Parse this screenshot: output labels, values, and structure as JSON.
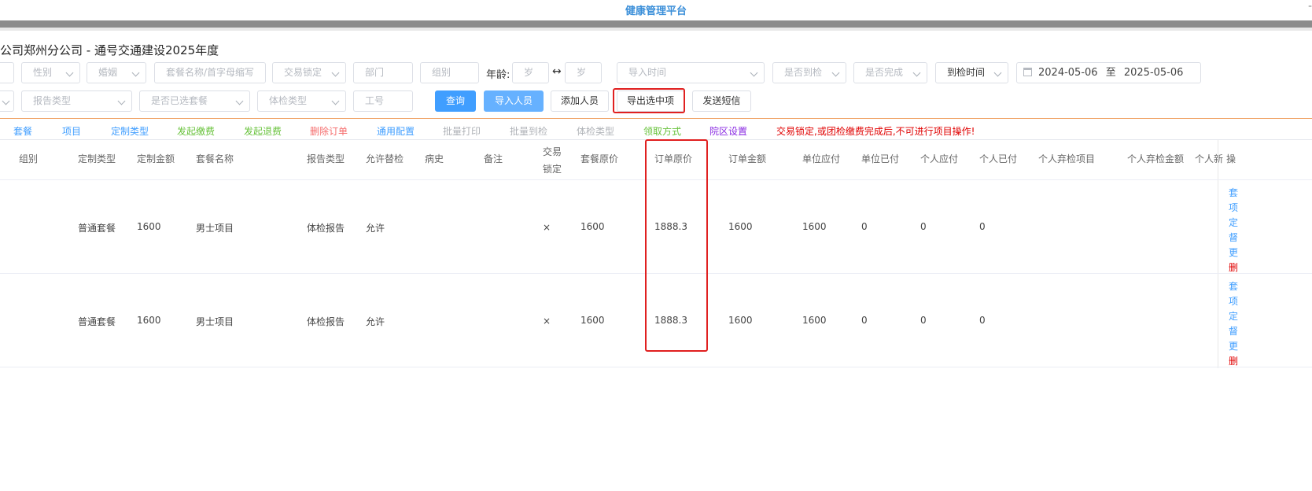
{
  "app": {
    "title": "健康管理平台",
    "minimize": "-"
  },
  "page": {
    "title": "公司郑州分公司 - 通号交通建设2025年度"
  },
  "filters": {
    "row1": {
      "gender": "性别",
      "marital": "婚姻",
      "package_search": "套餐名称/首字母缩写",
      "trade_lock": "交易锁定",
      "department": "部门",
      "group": "组别",
      "age_label": "年龄:",
      "age_from": "岁",
      "age_arrow": "↔",
      "age_to": "岁",
      "import_time": "导入时间",
      "is_checked_in": "是否到检",
      "is_completed": "是否完成",
      "checkin_time": "到检时间",
      "date_from": "2024-05-06",
      "date_sep": "至",
      "date_to": "2025-05-06"
    },
    "row2": {
      "report_type": "报告类型",
      "optional_package": "是否已选套餐",
      "exam_type": "体检类型",
      "employee_id": "工号"
    }
  },
  "buttons": {
    "query": "查询",
    "import_people": "导入人员",
    "add_person": "添加人员",
    "export_selected": "导出选中项",
    "send_sms": "发送短信"
  },
  "actions": [
    {
      "label": "套餐",
      "color": "#409eff"
    },
    {
      "label": "项目",
      "color": "#409eff"
    },
    {
      "label": "定制类型",
      "color": "#409eff"
    },
    {
      "label": "发起缴费",
      "color": "#67c23a"
    },
    {
      "label": "发起退费",
      "color": "#67c23a"
    },
    {
      "label": "删除订单",
      "color": "#f56c6c"
    },
    {
      "label": "通用配置",
      "color": "#409eff"
    },
    {
      "label": "批量打印",
      "color": "#b0b3b8"
    },
    {
      "label": "批量到检",
      "color": "#b0b3b8"
    },
    {
      "label": "体检类型",
      "color": "#b0b3b8"
    },
    {
      "label": "领取方式",
      "color": "#67c23a"
    },
    {
      "label": "院区设置",
      "color": "#8a2be2"
    }
  ],
  "warning": "交易锁定,或团检缴费完成后,不可进行项目操作!",
  "table": {
    "columns": [
      "组别",
      "定制类型",
      "定制金额",
      "套餐名称",
      "报告类型",
      "允许替检",
      "病史",
      "备注",
      "交易",
      "锁定",
      "套餐原价",
      "订单原价",
      "订单金额",
      "单位应付",
      "单位已付",
      "个人应付",
      "个人已付",
      "个人弃检项目",
      "个人弃检金额",
      "个人新",
      "操"
    ],
    "rows": [
      {
        "custom_type": "普通套餐",
        "custom_amount": "1600",
        "package_name": "男士项目",
        "report_type": "体检报告",
        "allow_substitute": "允许",
        "locked": "×",
        "package_price": "1600",
        "order_price": "1888.3",
        "order_amount": "1600",
        "unit_payable": "1600",
        "unit_paid": "0",
        "personal_payable": "0",
        "personal_paid": "0",
        "ops": [
          "套",
          "项",
          "定",
          "督",
          "更",
          "删"
        ]
      },
      {
        "custom_type": "普通套餐",
        "custom_amount": "1600",
        "package_name": "男士项目",
        "report_type": "体检报告",
        "allow_substitute": "允许",
        "locked": "×",
        "package_price": "1600",
        "order_price": "1888.3",
        "order_amount": "1600",
        "unit_payable": "1600",
        "unit_paid": "0",
        "personal_payable": "0",
        "personal_paid": "0",
        "ops": [
          "套",
          "项",
          "定",
          "督",
          "更",
          "删"
        ]
      }
    ]
  }
}
